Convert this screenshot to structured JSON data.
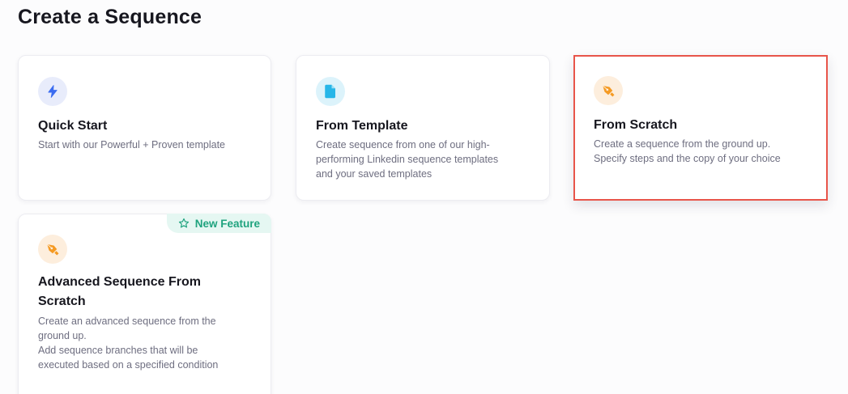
{
  "page": {
    "title": "Create a Sequence"
  },
  "cards": {
    "quick_start": {
      "title": "Quick Start",
      "desc": [
        "Start with our Powerful + Proven template"
      ],
      "icon": "lightning-icon",
      "icon_bg": "#e8ecfb",
      "icon_color": "#3b6cf0"
    },
    "from_template": {
      "title": "From Template",
      "desc": [
        "Create sequence from one of our high-",
        "performing Linkedin sequence templates",
        "and your saved templates"
      ],
      "icon": "document-icon",
      "icon_bg": "#dcf3fb",
      "icon_color": "#26b6e8"
    },
    "from_scratch": {
      "title": "From Scratch",
      "desc": [
        "Create a sequence from the ground up.",
        "Specify steps and the copy of your choice"
      ],
      "icon": "pen-nib-icon",
      "icon_bg": "#fdeedd",
      "icon_color": "#f59a23",
      "selected": true,
      "selected_color": "#e8554a"
    },
    "advanced": {
      "title": "Advanced Sequence From Scratch",
      "desc": [
        "Create an advanced sequence from the",
        "ground up.",
        "Add sequence branches that will be",
        "executed based on a specified condition"
      ],
      "icon": "pen-nib-icon",
      "icon_bg": "#fdeedd",
      "icon_color": "#f59a23",
      "badge": {
        "label": "New Feature",
        "icon": "star-outline-icon",
        "bg": "#e5f7f2",
        "color": "#1fa37e"
      }
    }
  }
}
